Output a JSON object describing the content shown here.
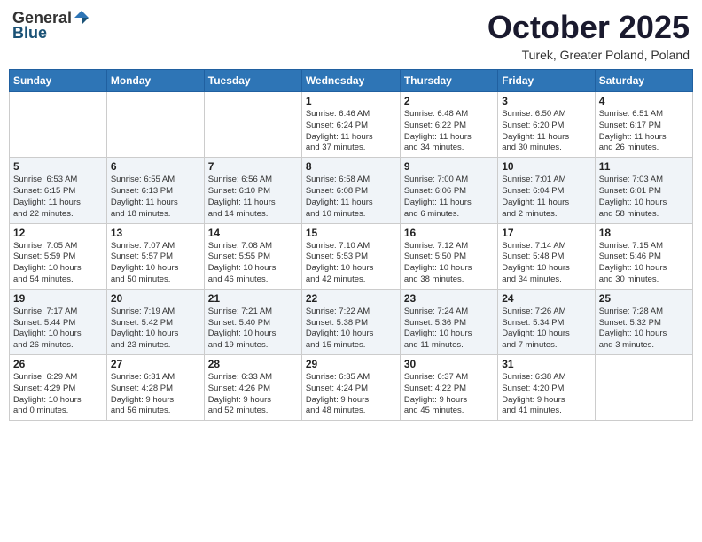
{
  "header": {
    "logo_general": "General",
    "logo_blue": "Blue",
    "month_title": "October 2025",
    "location": "Turek, Greater Poland, Poland"
  },
  "days_of_week": [
    "Sunday",
    "Monday",
    "Tuesday",
    "Wednesday",
    "Thursday",
    "Friday",
    "Saturday"
  ],
  "weeks": [
    [
      {
        "day": "",
        "info": ""
      },
      {
        "day": "",
        "info": ""
      },
      {
        "day": "",
        "info": ""
      },
      {
        "day": "1",
        "info": "Sunrise: 6:46 AM\nSunset: 6:24 PM\nDaylight: 11 hours\nand 37 minutes."
      },
      {
        "day": "2",
        "info": "Sunrise: 6:48 AM\nSunset: 6:22 PM\nDaylight: 11 hours\nand 34 minutes."
      },
      {
        "day": "3",
        "info": "Sunrise: 6:50 AM\nSunset: 6:20 PM\nDaylight: 11 hours\nand 30 minutes."
      },
      {
        "day": "4",
        "info": "Sunrise: 6:51 AM\nSunset: 6:17 PM\nDaylight: 11 hours\nand 26 minutes."
      }
    ],
    [
      {
        "day": "5",
        "info": "Sunrise: 6:53 AM\nSunset: 6:15 PM\nDaylight: 11 hours\nand 22 minutes."
      },
      {
        "day": "6",
        "info": "Sunrise: 6:55 AM\nSunset: 6:13 PM\nDaylight: 11 hours\nand 18 minutes."
      },
      {
        "day": "7",
        "info": "Sunrise: 6:56 AM\nSunset: 6:10 PM\nDaylight: 11 hours\nand 14 minutes."
      },
      {
        "day": "8",
        "info": "Sunrise: 6:58 AM\nSunset: 6:08 PM\nDaylight: 11 hours\nand 10 minutes."
      },
      {
        "day": "9",
        "info": "Sunrise: 7:00 AM\nSunset: 6:06 PM\nDaylight: 11 hours\nand 6 minutes."
      },
      {
        "day": "10",
        "info": "Sunrise: 7:01 AM\nSunset: 6:04 PM\nDaylight: 11 hours\nand 2 minutes."
      },
      {
        "day": "11",
        "info": "Sunrise: 7:03 AM\nSunset: 6:01 PM\nDaylight: 10 hours\nand 58 minutes."
      }
    ],
    [
      {
        "day": "12",
        "info": "Sunrise: 7:05 AM\nSunset: 5:59 PM\nDaylight: 10 hours\nand 54 minutes."
      },
      {
        "day": "13",
        "info": "Sunrise: 7:07 AM\nSunset: 5:57 PM\nDaylight: 10 hours\nand 50 minutes."
      },
      {
        "day": "14",
        "info": "Sunrise: 7:08 AM\nSunset: 5:55 PM\nDaylight: 10 hours\nand 46 minutes."
      },
      {
        "day": "15",
        "info": "Sunrise: 7:10 AM\nSunset: 5:53 PM\nDaylight: 10 hours\nand 42 minutes."
      },
      {
        "day": "16",
        "info": "Sunrise: 7:12 AM\nSunset: 5:50 PM\nDaylight: 10 hours\nand 38 minutes."
      },
      {
        "day": "17",
        "info": "Sunrise: 7:14 AM\nSunset: 5:48 PM\nDaylight: 10 hours\nand 34 minutes."
      },
      {
        "day": "18",
        "info": "Sunrise: 7:15 AM\nSunset: 5:46 PM\nDaylight: 10 hours\nand 30 minutes."
      }
    ],
    [
      {
        "day": "19",
        "info": "Sunrise: 7:17 AM\nSunset: 5:44 PM\nDaylight: 10 hours\nand 26 minutes."
      },
      {
        "day": "20",
        "info": "Sunrise: 7:19 AM\nSunset: 5:42 PM\nDaylight: 10 hours\nand 23 minutes."
      },
      {
        "day": "21",
        "info": "Sunrise: 7:21 AM\nSunset: 5:40 PM\nDaylight: 10 hours\nand 19 minutes."
      },
      {
        "day": "22",
        "info": "Sunrise: 7:22 AM\nSunset: 5:38 PM\nDaylight: 10 hours\nand 15 minutes."
      },
      {
        "day": "23",
        "info": "Sunrise: 7:24 AM\nSunset: 5:36 PM\nDaylight: 10 hours\nand 11 minutes."
      },
      {
        "day": "24",
        "info": "Sunrise: 7:26 AM\nSunset: 5:34 PM\nDaylight: 10 hours\nand 7 minutes."
      },
      {
        "day": "25",
        "info": "Sunrise: 7:28 AM\nSunset: 5:32 PM\nDaylight: 10 hours\nand 3 minutes."
      }
    ],
    [
      {
        "day": "26",
        "info": "Sunrise: 6:29 AM\nSunset: 4:29 PM\nDaylight: 10 hours\nand 0 minutes."
      },
      {
        "day": "27",
        "info": "Sunrise: 6:31 AM\nSunset: 4:28 PM\nDaylight: 9 hours\nand 56 minutes."
      },
      {
        "day": "28",
        "info": "Sunrise: 6:33 AM\nSunset: 4:26 PM\nDaylight: 9 hours\nand 52 minutes."
      },
      {
        "day": "29",
        "info": "Sunrise: 6:35 AM\nSunset: 4:24 PM\nDaylight: 9 hours\nand 48 minutes."
      },
      {
        "day": "30",
        "info": "Sunrise: 6:37 AM\nSunset: 4:22 PM\nDaylight: 9 hours\nand 45 minutes."
      },
      {
        "day": "31",
        "info": "Sunrise: 6:38 AM\nSunset: 4:20 PM\nDaylight: 9 hours\nand 41 minutes."
      },
      {
        "day": "",
        "info": ""
      }
    ]
  ]
}
